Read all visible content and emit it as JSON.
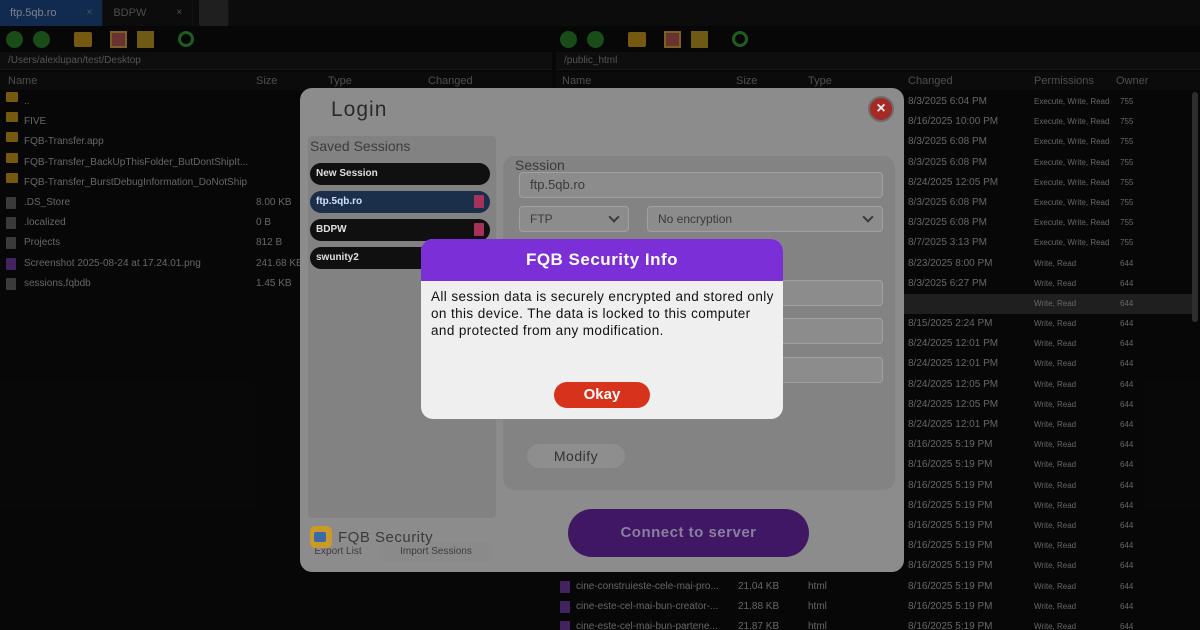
{
  "tabs": [
    {
      "label": "ftp.5qb.ro",
      "close": "×",
      "active": true
    },
    {
      "label": "BDPW",
      "close": "×",
      "active": false
    }
  ],
  "left_pane": {
    "path": "/Users/alexlupan/test/Desktop",
    "columns": [
      "Name",
      "Size",
      "Type",
      "Changed"
    ],
    "rows": [
      {
        "name": "..",
        "size": "",
        "kind": "folder"
      },
      {
        "name": "FIVE",
        "size": "",
        "kind": "folder"
      },
      {
        "name": "FQB-Transfer.app",
        "size": "",
        "kind": "folder"
      },
      {
        "name": "FQB-Transfer_BackUpThisFolder_ButDontShipIt...",
        "size": "",
        "kind": "folder"
      },
      {
        "name": "FQB-Transfer_BurstDebugInformation_DoNotShip",
        "size": "",
        "kind": "folder"
      },
      {
        "name": ".DS_Store",
        "size": "8.00 KB",
        "kind": "file"
      },
      {
        "name": ".localized",
        "size": "0 B",
        "kind": "file"
      },
      {
        "name": "Projects",
        "size": "812 B",
        "kind": "file"
      },
      {
        "name": "Screenshot 2025-08-24 at 17.24.01.png",
        "size": "241.68 KB",
        "kind": "img"
      },
      {
        "name": "sessions.fqbdb",
        "size": "1.45 KB",
        "kind": "file"
      }
    ]
  },
  "right_pane": {
    "path": "/public_html",
    "columns": [
      "Name",
      "Size",
      "Type",
      "Changed",
      "Permissions",
      "Owner"
    ],
    "rows": [
      {
        "changed": "8/3/2025 6:04 PM",
        "perm": "Execute, Write, Read",
        "owner": "755",
        "sel": false
      },
      {
        "changed": "8/16/2025 10:00 PM",
        "perm": "Execute, Write, Read",
        "owner": "755",
        "sel": false
      },
      {
        "changed": "8/3/2025 6:08 PM",
        "perm": "Execute, Write, Read",
        "owner": "755",
        "sel": false
      },
      {
        "changed": "8/3/2025 6:08 PM",
        "perm": "Execute, Write, Read",
        "owner": "755",
        "sel": false
      },
      {
        "changed": "8/24/2025 12:05 PM",
        "perm": "Execute, Write, Read",
        "owner": "755",
        "sel": false
      },
      {
        "changed": "8/3/2025 6:08 PM",
        "perm": "Execute, Write, Read",
        "owner": "755",
        "sel": false
      },
      {
        "changed": "8/3/2025 6:08 PM",
        "perm": "Execute, Write, Read",
        "owner": "755",
        "sel": false
      },
      {
        "changed": "8/7/2025 3:13 PM",
        "perm": "Execute, Write, Read",
        "owner": "755",
        "sel": false
      },
      {
        "changed": "8/23/2025 8:00 PM",
        "perm": "Write, Read",
        "owner": "644",
        "sel": false
      },
      {
        "changed": "8/3/2025 6:27 PM",
        "perm": "Write, Read",
        "owner": "644",
        "sel": false
      },
      {
        "changed": "",
        "perm": "Write, Read",
        "owner": "644",
        "sel": true
      },
      {
        "changed": "8/15/2025 2:24 PM",
        "perm": "Write, Read",
        "owner": "644",
        "sel": false
      },
      {
        "changed": "8/24/2025 12:01 PM",
        "perm": "Write, Read",
        "owner": "644",
        "sel": false
      },
      {
        "changed": "8/24/2025 12:01 PM",
        "perm": "Write, Read",
        "owner": "644",
        "sel": false
      },
      {
        "changed": "8/24/2025 12:05 PM",
        "perm": "Write, Read",
        "owner": "644",
        "sel": false
      },
      {
        "changed": "8/24/2025 12:05 PM",
        "perm": "Write, Read",
        "owner": "644",
        "sel": false
      },
      {
        "changed": "8/24/2025 12:01 PM",
        "perm": "Write, Read",
        "owner": "644",
        "sel": false
      },
      {
        "changed": "8/16/2025 5:19 PM",
        "perm": "Write, Read",
        "owner": "644",
        "sel": false
      },
      {
        "changed": "8/16/2025 5:19 PM",
        "perm": "Write, Read",
        "owner": "644",
        "sel": false
      },
      {
        "changed": "8/16/2025 5:19 PM",
        "perm": "Write, Read",
        "owner": "644",
        "sel": false
      },
      {
        "changed": "8/16/2025 5:19 PM",
        "perm": "Write, Read",
        "owner": "644",
        "sel": false
      },
      {
        "changed": "8/16/2025 5:19 PM",
        "perm": "Write, Read",
        "owner": "644",
        "sel": false
      },
      {
        "changed": "8/16/2025 5:19 PM",
        "perm": "Write, Read",
        "owner": "644",
        "sel": false
      },
      {
        "changed": "8/16/2025 5:19 PM",
        "perm": "Write, Read",
        "owner": "644",
        "sel": false
      },
      {
        "name": "cine-construieste-cele-mai-pro...",
        "size": "21.04 KB",
        "type": "html",
        "changed": "8/16/2025 5:19 PM",
        "perm": "Write, Read",
        "owner": "644",
        "sel": false
      },
      {
        "name": "cine-este-cel-mai-bun-creator-...",
        "size": "21.88 KB",
        "type": "html",
        "changed": "8/16/2025 5:19 PM",
        "perm": "Write, Read",
        "owner": "644",
        "sel": false
      },
      {
        "name": "cine-este-cel-mai-bun-partene...",
        "size": "21.87 KB",
        "type": "html",
        "changed": "8/16/2025 5:19 PM",
        "perm": "Write, Read",
        "owner": "644",
        "sel": false
      }
    ]
  },
  "login": {
    "title": "Login",
    "close": "×",
    "saved_title": "Saved Sessions",
    "sessions": [
      {
        "label": "New Session",
        "active": false,
        "trash": false
      },
      {
        "label": "ftp.5qb.ro",
        "active": true,
        "trash": true
      },
      {
        "label": "BDPW",
        "active": false,
        "trash": true
      },
      {
        "label": "swunity2",
        "active": false,
        "trash": false
      }
    ],
    "export_label": "Export List",
    "import_label": "Import Sessions",
    "brand": "FQB Security",
    "session_label": "Session",
    "host_value": "ftp.5qb.ro",
    "protocol_value": "FTP",
    "encryption_value": "No encryption",
    "modify_label": "Modify",
    "connect_label": "Connect to server"
  },
  "security_info": {
    "title": "FQB Security Info",
    "message": "All session data is securely encrypted and stored only on this device. The data is locked to this computer and protected from any modification.",
    "okay_label": "Okay"
  },
  "colors": {
    "accent_purple": "#7b2fd6",
    "okay_red": "#d6321c",
    "tab_blue": "#1f4f8f"
  }
}
